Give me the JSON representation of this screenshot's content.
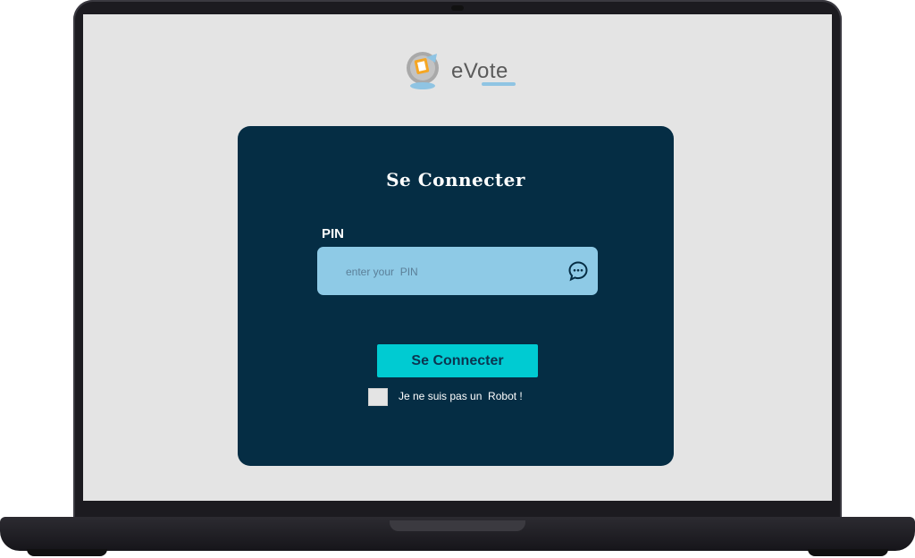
{
  "app": {
    "logo_text": "eVote",
    "logo_icon": "ballot-box-icon"
  },
  "login": {
    "title": "Se Connecter",
    "pin_label": "PIN",
    "pin_placeholder": "enter your  PIN",
    "pin_value": "",
    "pin_icon": "chat-bubble-icon",
    "submit_label": "Se Connecter",
    "robot_label": "Je ne suis pas un  Robot !",
    "robot_checked": false
  },
  "colors": {
    "card_bg": "#052d44",
    "input_bg": "#8ecae6",
    "button_bg": "#00cbd2",
    "screen_bg": "#e4e4e4"
  }
}
